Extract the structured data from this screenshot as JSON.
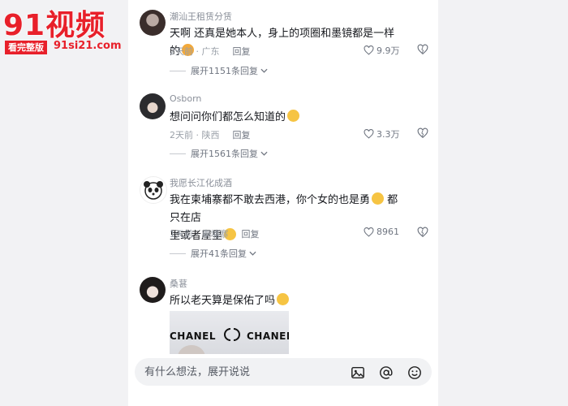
{
  "watermark": {
    "title": "91视频",
    "badge": "看完整版",
    "url": "91si21.com"
  },
  "comments": [
    {
      "username": "潮汕王租赁分赁",
      "text": "天啊 还真是她本人，身上的项圈和墨镜都是一样的",
      "time_location": "2天前 · 广东",
      "reply": "回复",
      "likes": "9.9万",
      "expand": "展开1151条回复"
    },
    {
      "username": "Osborn",
      "text": "想问问你们都怎么知道的",
      "time_location": "2天前 · 陕西",
      "reply": "回复",
      "likes": "3.3万",
      "expand": "展开1561条回复"
    },
    {
      "username": "我愿长江化成酒",
      "text_line1": "我在柬埔寨都不敢去西港，你个女的也是勇",
      "text_line1b": "都只在店",
      "text_line2": "里或者屋里",
      "time_location": "1天前 · 柬埔寨",
      "reply": "回复",
      "likes": "8961",
      "expand": "展开41条回复"
    },
    {
      "username": "桑葚",
      "text": "所以老天算是保佑了吗",
      "photo_brand_left": "CHANEL",
      "photo_brand_right": "CHANEL"
    }
  ],
  "input": {
    "placeholder": "有什么想法，展开说说"
  },
  "colors": {
    "watermark_red": "#e8202a",
    "text": "#16181d",
    "meta": "#9aa0a8",
    "emoji": "#f6c443"
  },
  "icons": [
    "heart-icon",
    "dislike-heart-icon",
    "chevron-down-icon",
    "image-icon",
    "at-icon",
    "emoji-icon",
    "cursor-icon"
  ]
}
